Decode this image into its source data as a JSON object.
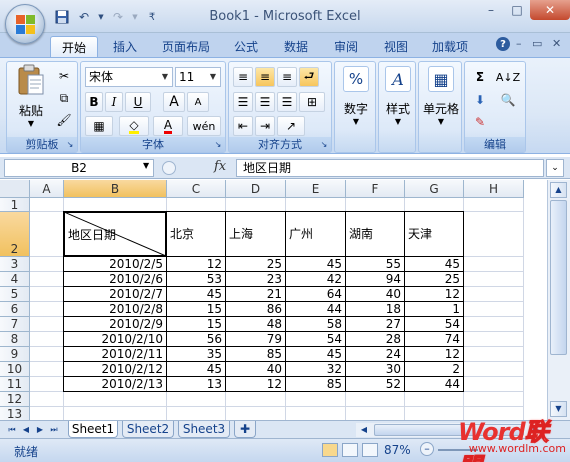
{
  "window": {
    "title": "Book1 - Microsoft Excel"
  },
  "ribbon": {
    "tabs": [
      "开始",
      "插入",
      "页面布局",
      "公式",
      "数据",
      "审阅",
      "视图",
      "加载项"
    ],
    "active_tab": "开始",
    "clipboard": {
      "paste_label": "粘贴",
      "group_label": "剪贴板"
    },
    "font": {
      "font_name": "宋体",
      "font_size": "11",
      "group_label": "字体",
      "bold": "B",
      "italic": "I",
      "underline": "U",
      "grow": "A",
      "shrink": "A",
      "pinyin": "wén"
    },
    "alignment": {
      "group_label": "对齐方式"
    },
    "number": {
      "label": "数字",
      "symbol": "%"
    },
    "styles": {
      "label": "样式"
    },
    "cells": {
      "label": "单元格"
    },
    "editing": {
      "group_label": "编辑",
      "sum_symbol": "Σ"
    }
  },
  "formula_bar": {
    "name_box": "B2",
    "fx": "fx",
    "value": "地区日期"
  },
  "sheet": {
    "columns": [
      "A",
      "B",
      "C",
      "D",
      "E",
      "F",
      "G",
      "H"
    ],
    "rows": [
      "1",
      "2",
      "3",
      "4",
      "5",
      "6",
      "7",
      "8",
      "9",
      "10",
      "11",
      "12",
      "13"
    ],
    "header_cell": "地区日期",
    "regions": [
      "北京",
      "上海",
      "广州",
      "湖南",
      "天津"
    ],
    "records": [
      {
        "date": "2010/2/5",
        "values": [
          "12",
          "25",
          "45",
          "55",
          "45"
        ]
      },
      {
        "date": "2010/2/6",
        "values": [
          "53",
          "23",
          "42",
          "94",
          "25"
        ]
      },
      {
        "date": "2010/2/7",
        "values": [
          "45",
          "21",
          "64",
          "40",
          "12"
        ]
      },
      {
        "date": "2010/2/8",
        "values": [
          "15",
          "86",
          "44",
          "18",
          "1"
        ]
      },
      {
        "date": "2010/2/9",
        "values": [
          "15",
          "48",
          "58",
          "27",
          "54"
        ]
      },
      {
        "date": "2010/2/10",
        "values": [
          "56",
          "79",
          "54",
          "28",
          "74"
        ]
      },
      {
        "date": "2010/2/11",
        "values": [
          "35",
          "85",
          "45",
          "24",
          "12"
        ]
      },
      {
        "date": "2010/2/12",
        "values": [
          "45",
          "40",
          "32",
          "30",
          "2"
        ]
      },
      {
        "date": "2010/2/13",
        "values": [
          "13",
          "12",
          "85",
          "52",
          "44"
        ]
      }
    ]
  },
  "sheet_tabs": [
    "Sheet1",
    "Sheet2",
    "Sheet3"
  ],
  "active_sheet": "Sheet1",
  "status": {
    "mode": "就绪",
    "zoom": "87%"
  },
  "watermark": {
    "brand_a": "Word",
    "brand_b": "联盟",
    "url": "www.wordlm.com"
  }
}
